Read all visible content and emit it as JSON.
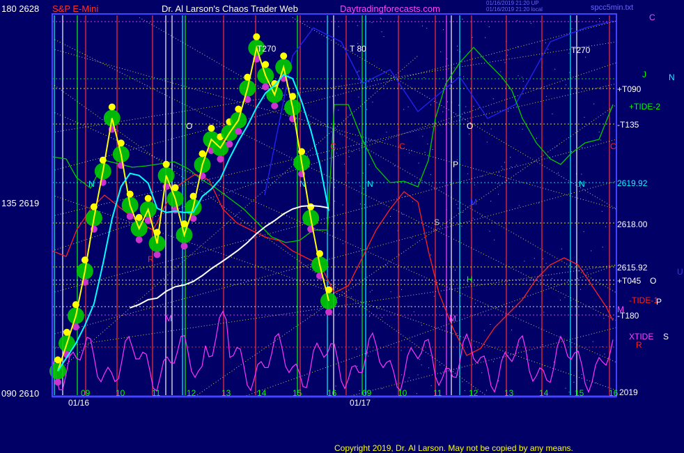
{
  "header": {
    "y_top_label": "180 2628",
    "instrument": "S&P E-Mini",
    "author": "Dr. Al Larson's Chaos Trader Web",
    "site": "Daytradingforecasts.com",
    "timestamp1": "01/16/2019 21:20 UP",
    "timestamp2": "01/16/2019 21:20 local",
    "file": "spcc5min.txt"
  },
  "axis_left": {
    "mid": "135 2619",
    "bottom": "090 2610"
  },
  "x_axis": {
    "date1": "01/16",
    "date2": "01/17",
    "ticks": [
      "09",
      "10",
      "11",
      "12",
      "13",
      "14",
      "15",
      "16",
      "09",
      "10",
      "11",
      "12",
      "13",
      "14",
      "15",
      "16"
    ]
  },
  "right_labels": {
    "c_top": "C",
    "j": "J",
    "n": "N",
    "t090": "+T090",
    "tide2": "+TIDE-2",
    "t135": "-T135",
    "p2619": "2619.92",
    "p2618": "2618.00",
    "p2615": "2615.92",
    "t045": "+T045",
    "o": "O",
    "u": "U",
    "tide1": "-TIDE-1",
    "p": "P",
    "m": "M",
    "t180": "-T180",
    "xtide": "XTIDE",
    "s": "S",
    "r": "R",
    "year": "2019"
  },
  "plot_letters": {
    "t270a": "T270",
    "t80": "T 80",
    "t270b": "T270",
    "o1": "O",
    "o2": "O",
    "n1": "N",
    "n2": "N",
    "n3": "N",
    "n4": "N",
    "c1": "C",
    "c2": "C",
    "c3": "C",
    "p1": "P",
    "s1": "S",
    "h1": "H",
    "m1": "M",
    "m2": "M",
    "r1": "R",
    "m3": "M"
  },
  "copyright": "Copyright 2019, Dr. Al Larson. May not be copied by any means.",
  "colors": {
    "background": "#000066",
    "price": "#ffff00",
    "average": "#00ffff",
    "long_average": "#ffffff",
    "green_forecast": "#00cc00",
    "red_forecast": "#ff2020",
    "magenta_oscillator": "#ff33ff",
    "frame": "#4444ff"
  },
  "chart_data": {
    "type": "line",
    "instrument": "S&P E-Mini",
    "yticks": [
      "2628",
      "2619",
      "2610"
    ],
    "price_levels": [
      2619.92,
      2618.0,
      2615.92
    ],
    "x_dates": [
      "01/16",
      "01/17"
    ],
    "series": [
      {
        "name": "S&P E-Mini",
        "color": "#ffff00",
        "values": [
          2611.2,
          2612.5,
          2613.8,
          2615.9,
          2618.4,
          2620.6,
          2623.1,
          2621.4,
          2619.0,
          2617.9,
          2618.8,
          2617.2,
          2620.4,
          2619.3,
          2617.6,
          2618.9,
          2620.9,
          2622.1,
          2621.7,
          2622.4,
          2623.0,
          2624.5,
          2626.4,
          2625.1,
          2624.2,
          2625.5,
          2623.6,
          2621.0,
          2618.4,
          2616.2,
          2614.5
        ]
      }
    ],
    "ylim": [
      2610,
      2628
    ],
    "grid": true
  }
}
